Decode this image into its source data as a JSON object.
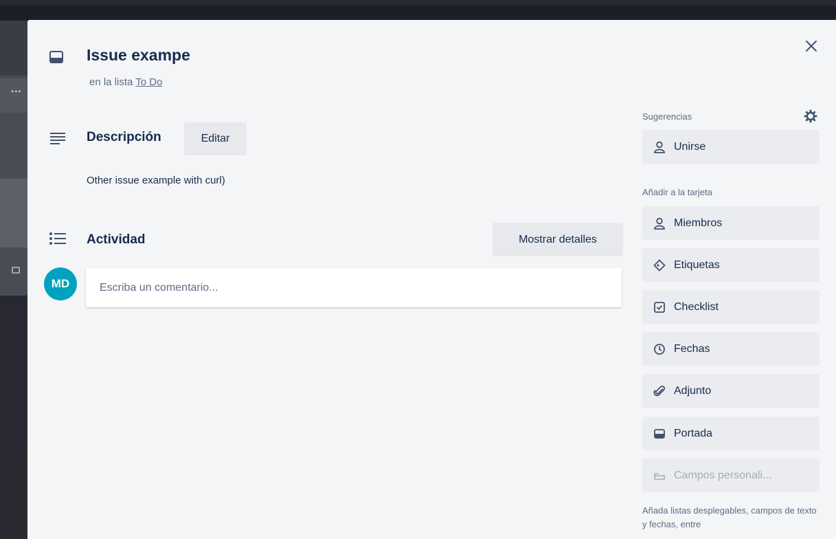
{
  "card": {
    "title": "Issue exampe",
    "list_prefix": "en la lista",
    "list_name": "To Do"
  },
  "description": {
    "heading": "Descripción",
    "edit_label": "Editar",
    "text": "Other issue example with curl)"
  },
  "activity": {
    "heading": "Actividad",
    "details_label": "Mostrar detalles",
    "avatar_initials": "MD",
    "comment_placeholder": "Escriba un comentario..."
  },
  "sidebar": {
    "suggestions_heading": "Sugerencias",
    "join_label": "Unirse",
    "add_heading": "Añadir a la tarjeta",
    "items": [
      {
        "label": "Miembros",
        "icon": "person-icon"
      },
      {
        "label": "Etiquetas",
        "icon": "tag-icon"
      },
      {
        "label": "Checklist",
        "icon": "checklist-icon"
      },
      {
        "label": "Fechas",
        "icon": "clock-icon"
      },
      {
        "label": "Adjunto",
        "icon": "paperclip-icon"
      },
      {
        "label": "Portada",
        "icon": "cover-icon"
      }
    ],
    "custom_fields_label": "Campos personali...",
    "custom_fields_note": "Añada listas desplegables, campos de texto y fechas, entre"
  },
  "colors": {
    "avatar": "#00a3bf",
    "modal_bg": "#f4f5f7",
    "button_bg": "#ebecf0"
  }
}
